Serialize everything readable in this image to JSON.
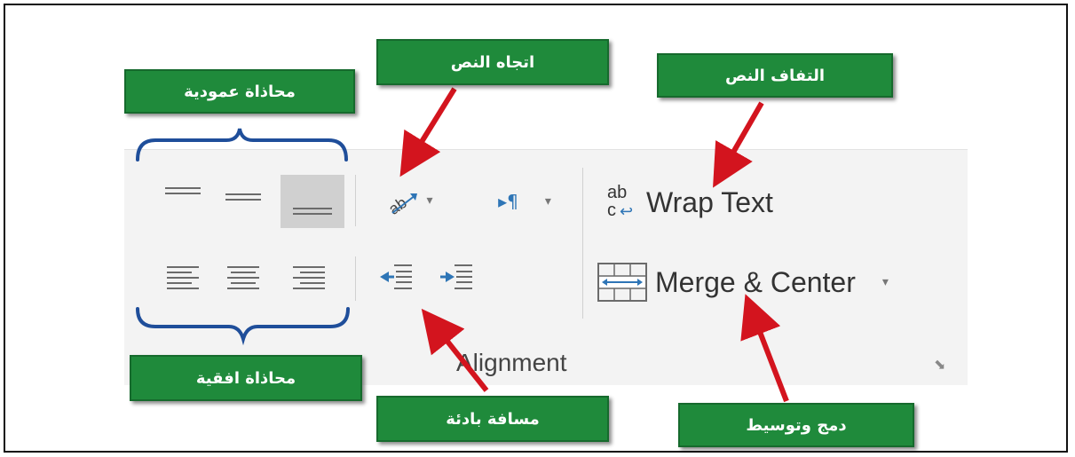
{
  "ribbon": {
    "wrap_text_label": "Wrap Text",
    "merge_center_label": "Merge & Center",
    "group_label": "Alignment",
    "wrap_icon_top": "ab",
    "wrap_icon_bottom": "c",
    "paragraph_icon": "▸¶",
    "dropdown_glyph": "▾",
    "launcher_glyph": "⬊"
  },
  "annotations": {
    "vertical_alignment": "محاذاة عمودية",
    "text_direction": "اتجاه النص",
    "wrap_text": "التفاف النص",
    "horizontal_alignment": "محاذاة افقية",
    "indent": "مسافة بادئة",
    "merge_center": "دمج وتوسيط"
  },
  "colors": {
    "label_green": "#1f8a3b",
    "arrow_red": "#d3141e",
    "bracket_blue": "#1f4e9a",
    "icon_blue": "#2e75b6"
  }
}
